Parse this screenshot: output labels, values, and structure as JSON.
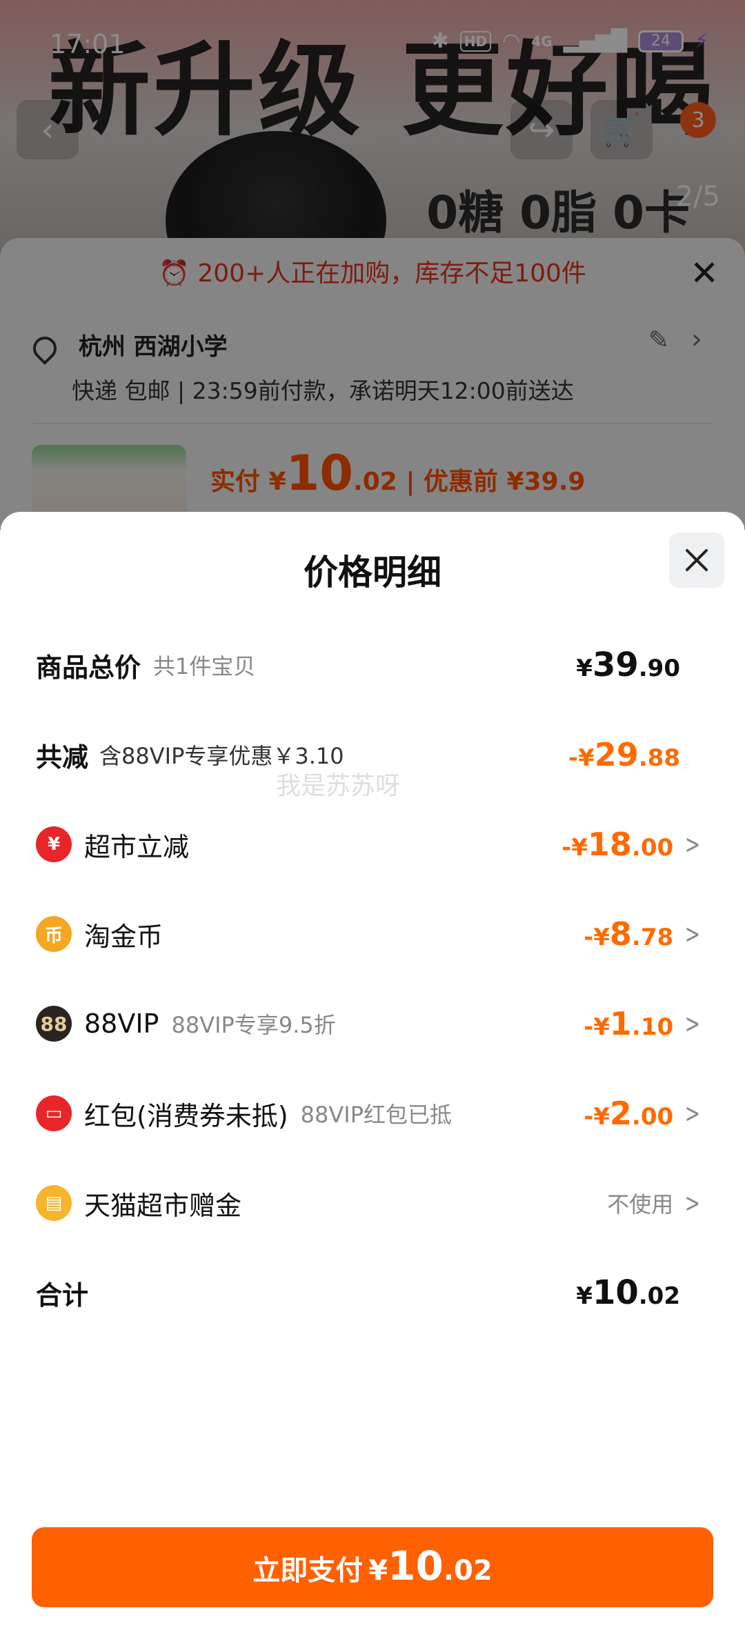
{
  "status_bar": {
    "time": "17:01",
    "hd_label": "HD",
    "network": "4G",
    "battery": "24"
  },
  "background": {
    "banner_text": "新升级 更好喝",
    "banner_sub": "0糖 0脂 0卡",
    "cart_count": "3",
    "image_counter": "2/5",
    "stock_warning": "200+人正在加购，库存不足100件",
    "address": "杭州 西湖小学",
    "delivery": "快递 包邮 | 23:59前付款，承诺明天12:00前送达",
    "pay_prefix": "实付 ¥",
    "pay_int": "10",
    "pay_dec": ".02",
    "pay_original": " | 优惠前 ¥39.9"
  },
  "modal": {
    "title": "价格明细",
    "watermark": "我是苏苏呀",
    "rows": [
      {
        "label": "商品总价",
        "note": "共1件宝贝",
        "cur": "¥",
        "int": "39",
        "dec": ".90"
      },
      {
        "label": "共减",
        "note": "含88VIP专享优惠￥3.10",
        "cur": "-¥",
        "int": "29",
        "dec": ".88"
      },
      {
        "label": "超市立减",
        "icon": "coupon-yen-icon",
        "cur": "-¥",
        "int": "18",
        "dec": ".00"
      },
      {
        "label": "淘金币",
        "icon": "taojinbi-coin-icon",
        "icon_glyph": "币",
        "cur": "-¥",
        "int": "8",
        "dec": ".78"
      },
      {
        "label": "88VIP",
        "icon": "vip88-icon",
        "icon_glyph": "88",
        "note": "88VIP专享9.5折",
        "cur": "-¥",
        "int": "1",
        "dec": ".10"
      },
      {
        "label": "红包(消费券未抵)",
        "icon": "red-envelope-icon",
        "note": "88VIP红包已抵",
        "cur": "-¥",
        "int": "2",
        "dec": ".00"
      },
      {
        "label": "天猫超市赠金",
        "icon": "gift-card-icon",
        "value_text": "不使用"
      },
      {
        "label": "合计",
        "cur": "¥",
        "int": "10",
        "dec": ".02"
      }
    ],
    "pay_button": {
      "label": "立即支付",
      "cur": "¥",
      "int": "10",
      "dec": ".02"
    }
  },
  "colors": {
    "accent": "#ff6000",
    "discount": "#ff6a00",
    "warning": "#e2331d"
  }
}
